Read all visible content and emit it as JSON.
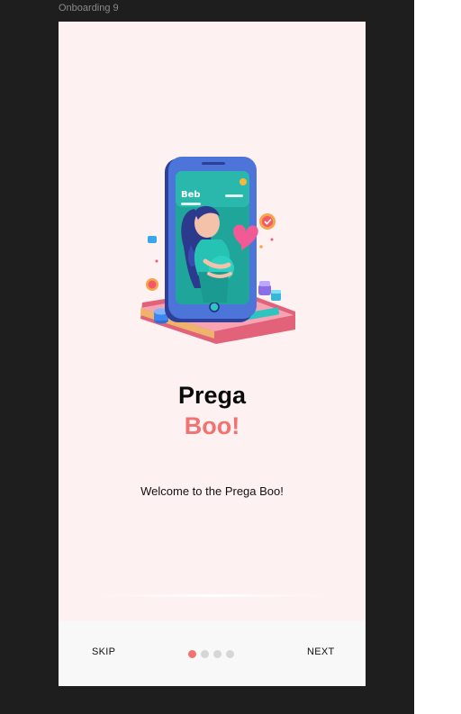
{
  "editor": {
    "frame_name": "Onboarding 9"
  },
  "onboarding": {
    "title_line1": "Prega",
    "title_line2": "Boo!",
    "subtitle": "Welcome to the Prega Boo!",
    "illustration": "pregnant-woman-phone-illustration",
    "illustration_screen_text": "Beb",
    "colors": {
      "background": "#fdf2f1",
      "accent": "#f07272",
      "title": "#0a0a0a",
      "dot_inactive": "#d6d6d6",
      "bottom_bar": "#f8f8f8"
    }
  },
  "footer": {
    "skip_label": "SKIP",
    "next_label": "NEXT",
    "page_count": 4,
    "active_page": 1
  }
}
